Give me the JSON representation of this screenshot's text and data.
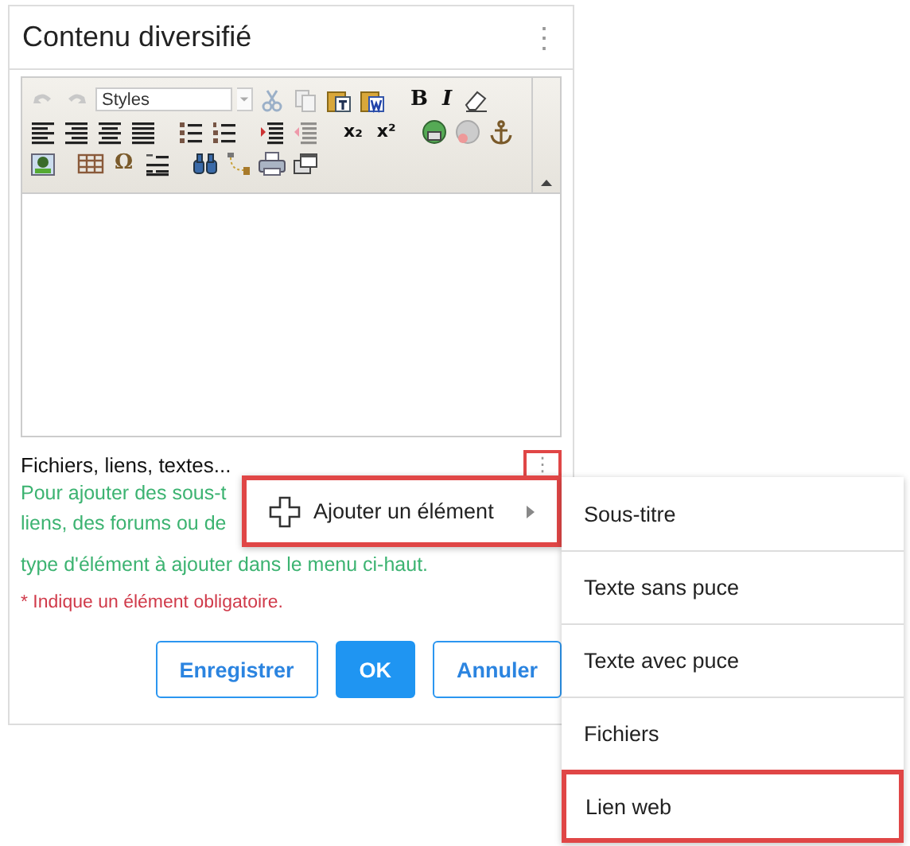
{
  "panel": {
    "title": "Contenu diversifié",
    "menu_glyph": "⋮"
  },
  "editor": {
    "style_select": "Styles",
    "glyphs": {
      "bold": "B",
      "italic": "I",
      "subscript": "x₂",
      "superscript": "x²",
      "omega": "Ω"
    }
  },
  "section": {
    "label": "Fichiers, liens, textes...",
    "menu_glyph": "⋮",
    "menu_highlighted": true,
    "help_lines": [
      "Pour ajouter des sous-t",
      "liens, des forums ou de",
      "type d'élément à ajouter dans le menu ci-haut."
    ],
    "required_note": "* Indique un élément obligatoire."
  },
  "buttons": [
    {
      "label": "Enregistrer",
      "kind": "outline"
    },
    {
      "label": "OK",
      "kind": "primary"
    },
    {
      "label": "Annuler",
      "kind": "outline"
    }
  ],
  "context_menu": {
    "items": [
      {
        "label": "Ajouter un élément",
        "highlighted": true
      }
    ]
  },
  "submenu": {
    "items": [
      {
        "label": "Sous-titre",
        "highlighted": false
      },
      {
        "label": "Texte sans puce",
        "highlighted": false
      },
      {
        "label": "Texte avec puce",
        "highlighted": false
      },
      {
        "label": "Fichiers",
        "highlighted": false
      },
      {
        "label": "Lien web",
        "highlighted": true
      }
    ]
  }
}
